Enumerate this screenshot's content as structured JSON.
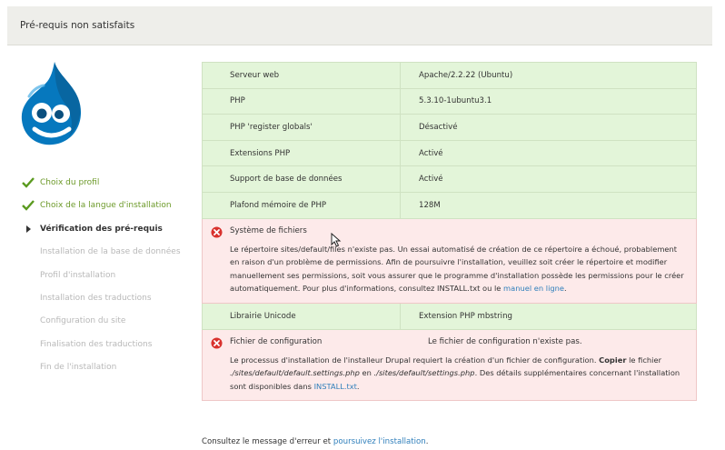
{
  "header": {
    "title": "Pré-requis non satisfaits"
  },
  "steps": [
    {
      "label": "Choix du profil",
      "state": "done"
    },
    {
      "label": "Choix de la langue d'installation",
      "state": "done"
    },
    {
      "label": "Vérification des pré-requis",
      "state": "active"
    },
    {
      "label": "Installation de la base de données",
      "state": "pending"
    },
    {
      "label": "Profil d'installation",
      "state": "pending"
    },
    {
      "label": "Installation des traductions",
      "state": "pending"
    },
    {
      "label": "Configuration du site",
      "state": "pending"
    },
    {
      "label": "Finalisation des traductions",
      "state": "pending"
    },
    {
      "label": "Fin de l'installation",
      "state": "pending"
    }
  ],
  "requirements": {
    "rows": [
      {
        "name": "Serveur web",
        "value": "Apache/2.2.22 (Ubuntu)"
      },
      {
        "name": "PHP",
        "value": "5.3.10-1ubuntu3.1"
      },
      {
        "name": "PHP 'register globals'",
        "value": "Désactivé"
      },
      {
        "name": "Extensions PHP",
        "value": "Activé"
      },
      {
        "name": "Support de base de données",
        "value": "Activé"
      },
      {
        "name": "Plafond mémoire de PHP",
        "value": "128M"
      }
    ],
    "filesystem_error": {
      "title": "Système de fichiers",
      "desc_pre": "Le répertoire sites/default/files n'existe pas. Un essai automatisé de création de ce répertoire a échoué, probablement en raison d'un problème de permissions. Afin de poursuivre l'installation, veuillez soit créer le répertoire et modifier manuellement ses permissions, soit vous assurer que le programme d'installation possède les permissions pour le créer automatiquement. Pour plus d'informations, consultez INSTALL.txt ou le ",
      "link": "manuel en ligne",
      "desc_post": "."
    },
    "unicode": {
      "name": "Librairie Unicode",
      "value": "Extension PHP mbstring"
    },
    "config_error": {
      "title": "Fichier de configuration",
      "value": "Le fichier de configuration n'existe pas.",
      "desc_1": "Le processus d'installation de l'installeur Drupal requiert la création d'un fichier de configuration. ",
      "copy_word": "Copier",
      "desc_2": " le fichier ",
      "file_src": "./sites/default/default.settings.php",
      "desc_3": " en ",
      "file_dst": "./sites/default/settings.php",
      "desc_4": ". Des détails supplémentaires concernant l'installation sont disponibles dans ",
      "link": "INSTALL.txt",
      "desc_5": "."
    }
  },
  "footer": {
    "text": "Consultez le message d'erreur et ",
    "link": "poursuivez l'installation",
    "end": "."
  },
  "colors": {
    "ok_bg": "#e3f5d9",
    "error_bg": "#fdeaea",
    "link": "#2f7fbb",
    "done_step": "#6d9a2a",
    "drupal_blue": "#0678be"
  }
}
